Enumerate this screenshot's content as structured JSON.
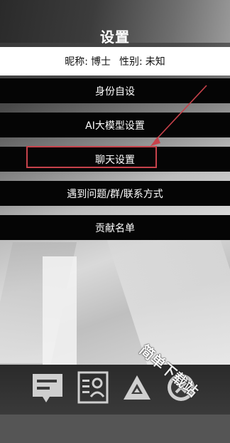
{
  "header": {
    "title": "设置"
  },
  "profile": {
    "nickname_label": "昵称:",
    "nickname_value": "博士",
    "gender_label": "性别:",
    "gender_value": "未知"
  },
  "menu": {
    "identity": "身份自设",
    "ai_model": "AI大模型设置",
    "chat": "聊天设置",
    "contact": "遇到问题/群/联系方式",
    "contributors": "贡献名单"
  },
  "watermark": {
    "text": "简单下载站"
  },
  "colors": {
    "highlight": "#c7424b",
    "button_bg": "#050505",
    "profile_bg": "#ffffff"
  },
  "icons": {
    "nav1": "chat-bubble-icon",
    "nav2": "contact-card-icon",
    "nav3": "triangle-logo-icon",
    "nav4": "close-gear-icon"
  }
}
